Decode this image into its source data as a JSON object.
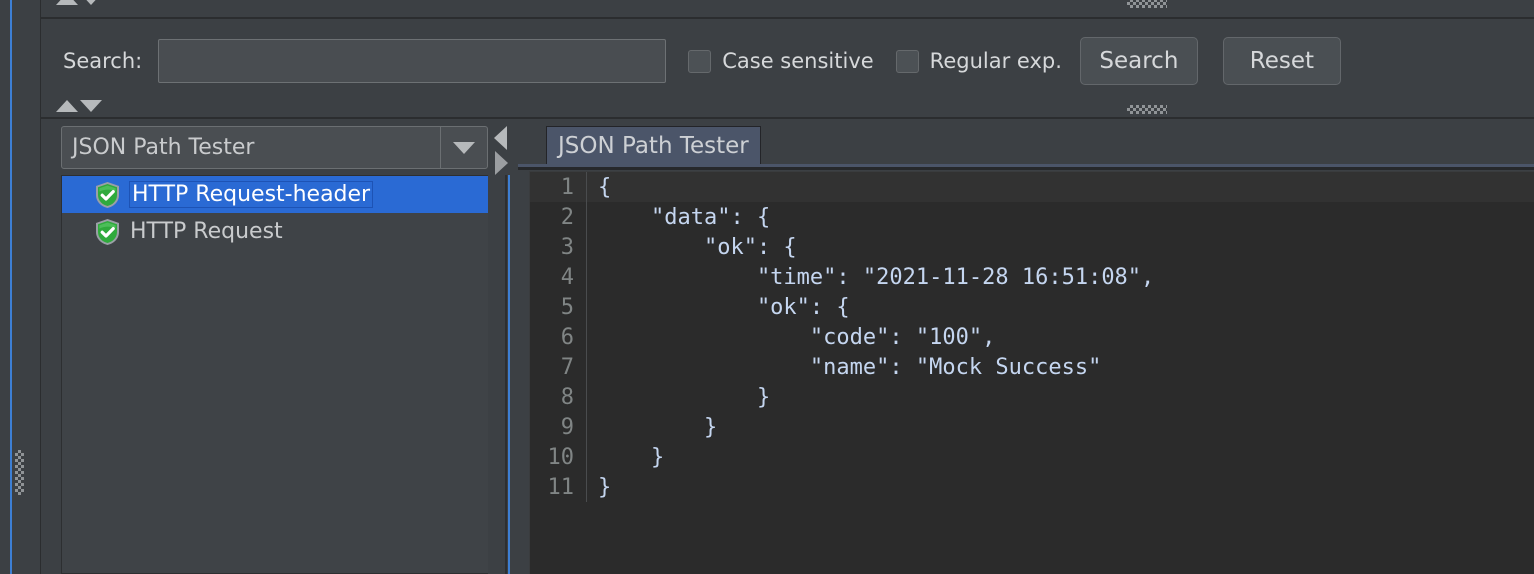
{
  "colors": {
    "panel_bg": "#3c4044",
    "editor_bg": "#2b2b2b",
    "accent_blue": "#3d7fd4",
    "selection_blue": "#2a6ad4",
    "tab_blue": "#4b5569",
    "shield_green": "#2faa3c",
    "text": "#d6d8da",
    "code_text": "#c5d6f0",
    "gutter_text": "#808585"
  },
  "search": {
    "label": "Search:",
    "value": "",
    "placeholder": "",
    "case_sensitive": {
      "label": "Case sensitive",
      "checked": false
    },
    "regular_exp": {
      "label": "Regular exp.",
      "checked": false
    },
    "search_button": "Search",
    "reset_button": "Reset"
  },
  "tree_panel": {
    "combo_selected": "JSON Path Tester",
    "items": [
      {
        "label": "HTTP Request-header",
        "icon": "shield-check-icon",
        "selected": true
      },
      {
        "label": "HTTP Request",
        "icon": "shield-check-icon",
        "selected": false
      }
    ]
  },
  "editor_panel": {
    "tabs": [
      {
        "label": "JSON Path Tester",
        "active": true
      }
    ],
    "code_lines": [
      {
        "n": "1",
        "text": "{"
      },
      {
        "n": "2",
        "text": "    \"data\": {"
      },
      {
        "n": "3",
        "text": "        \"ok\": {"
      },
      {
        "n": "4",
        "text": "            \"time\": \"2021-11-28 16:51:08\","
      },
      {
        "n": "5",
        "text": "            \"ok\": {"
      },
      {
        "n": "6",
        "text": "                \"code\": \"100\","
      },
      {
        "n": "7",
        "text": "                \"name\": \"Mock Success\""
      },
      {
        "n": "8",
        "text": "            }"
      },
      {
        "n": "9",
        "text": "        }"
      },
      {
        "n": "10",
        "text": "    }"
      },
      {
        "n": "11",
        "text": "}"
      }
    ],
    "current_line_index": 0
  },
  "chrome": {
    "collapse_up_icon": "triangle-up-icon",
    "collapse_down_icon": "triangle-down-icon",
    "grip_icon": "drag-grip-icon",
    "splitter_left_icon": "triangle-left-icon",
    "splitter_right_icon": "triangle-right-icon"
  }
}
